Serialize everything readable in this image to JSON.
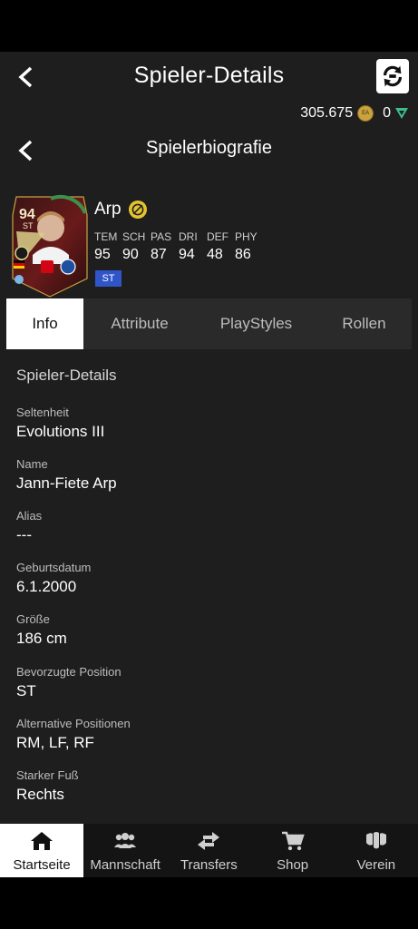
{
  "header": {
    "title": "Spieler-Details"
  },
  "currency": {
    "coins": "305.675",
    "points": "0"
  },
  "sub_header": {
    "title": "Spielerbiografie"
  },
  "player": {
    "card_rating": "94",
    "card_position": "ST",
    "name": "Arp",
    "stats": [
      {
        "label": "TEM",
        "value": "95"
      },
      {
        "label": "SCH",
        "value": "90"
      },
      {
        "label": "PAS",
        "value": "87"
      },
      {
        "label": "DRI",
        "value": "94"
      },
      {
        "label": "DEF",
        "value": "48"
      },
      {
        "label": "PHY",
        "value": "86"
      }
    ],
    "position_badge": "ST"
  },
  "tabs": [
    "Info",
    "Attribute",
    "PlayStyles",
    "Rollen"
  ],
  "details": {
    "section_title": "Spieler-Details",
    "fields": [
      {
        "label": "Seltenheit",
        "value": "Evolutions III"
      },
      {
        "label": "Name",
        "value": "Jann-Fiete Arp"
      },
      {
        "label": "Alias",
        "value": "---"
      },
      {
        "label": "Geburtsdatum",
        "value": "6.1.2000"
      },
      {
        "label": "Größe",
        "value": "186 cm"
      },
      {
        "label": "Bevorzugte Position",
        "value": "ST"
      },
      {
        "label": "Alternative Positionen",
        "value": "RM, LF, RF"
      },
      {
        "label": "Starker Fuß",
        "value": "Rechts"
      }
    ]
  },
  "nav": [
    "Startseite",
    "Mannschaft",
    "Transfers",
    "Shop",
    "Verein"
  ],
  "colors": {
    "background": "#1e1e1e",
    "accent_blue": "#2f55c9",
    "coin": "#c9a241",
    "points": "#3bbf8a"
  }
}
